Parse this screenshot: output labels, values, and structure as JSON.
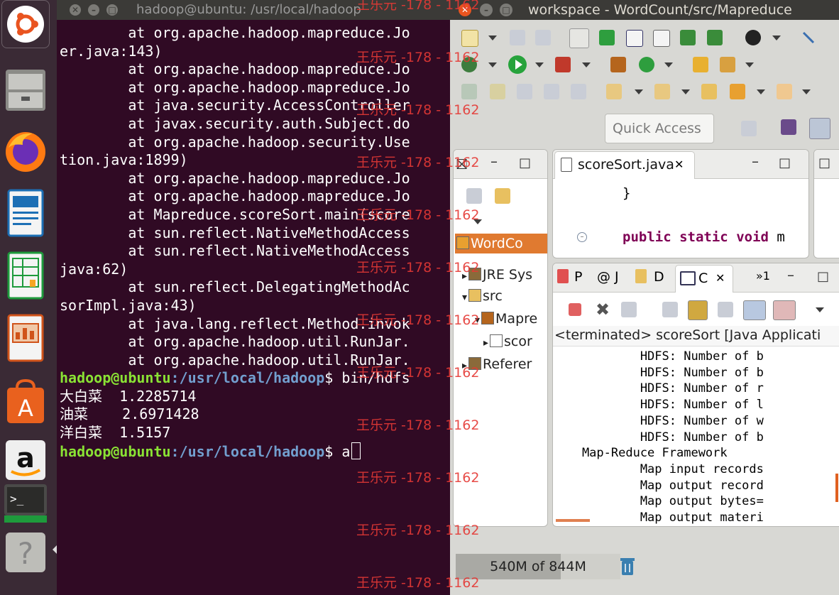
{
  "terminal": {
    "title": "hadoop@ubuntu: /usr/local/hadoop",
    "lines": [
      {
        "t": "        at org.apache.hadoop.mapreduce.Jo"
      },
      {
        "t": "er.java:143)"
      },
      {
        "t": "        at org.apache.hadoop.mapreduce.Jo"
      },
      {
        "t": "        at org.apache.hadoop.mapreduce.Jo"
      },
      {
        "t": "        at java.security.AccessController"
      },
      {
        "t": "        at javax.security.auth.Subject.do"
      },
      {
        "t": "        at org.apache.hadoop.security.Use"
      },
      {
        "t": "tion.java:1899)"
      },
      {
        "t": "        at org.apache.hadoop.mapreduce.Jo"
      },
      {
        "t": "        at org.apache.hadoop.mapreduce.Jo"
      },
      {
        "t": "        at Mapreduce.scoreSort.main(score"
      },
      {
        "t": "        at sun.reflect.NativeMethodAccess"
      },
      {
        "t": "        at sun.reflect.NativeMethodAccess"
      },
      {
        "t": "java:62)"
      },
      {
        "t": "        at sun.reflect.DelegatingMethodAc"
      },
      {
        "t": "sorImpl.java:43)"
      },
      {
        "t": "        at java.lang.reflect.Method.invok"
      },
      {
        "t": "        at org.apache.hadoop.util.RunJar."
      },
      {
        "t": "        at org.apache.hadoop.util.RunJar."
      },
      {
        "user": "hadoop@ubuntu",
        "path": ":/usr/local/hadoop",
        "cmd": "$ bin/hdfs"
      },
      {
        "t": "大白菜  1.2285714"
      },
      {
        "t": "油菜    2.6971428"
      },
      {
        "t": "洋白菜  1.5157"
      },
      {
        "user": "hadoop@ubuntu",
        "path": ":/usr/local/hadoop",
        "cmd": "$ a",
        "cursor": true
      }
    ]
  },
  "eclipse": {
    "title": "workspace - WordCount/src/Mapreduce",
    "quick_access": "Quick Access",
    "explorer_tree": [
      {
        "label": "WordCo",
        "selected": true
      },
      {
        "label": "JRE Sys"
      },
      {
        "label": "src"
      },
      {
        "label": "Mapre"
      },
      {
        "label": "scor"
      },
      {
        "label": "Referer"
      }
    ],
    "editor_tab": "scoreSort.java",
    "code_brace": "}",
    "code_kw1": "public",
    "code_kw2": "static",
    "code_kw3": "void",
    "code_rest": " m",
    "bottom_tabs": [
      "P",
      "@ J",
      "D",
      "C"
    ],
    "overflow_count": "»1",
    "console_header": "<terminated> scoreSort [Java Applicati",
    "console_lines": [
      "            HDFS: Number of b",
      "            HDFS: Number of b",
      "            HDFS: Number of r",
      "            HDFS: Number of l",
      "            HDFS: Number of w",
      "            HDFS: Number of b",
      "    Map-Reduce Framework",
      "            Map input records",
      "            Map output record",
      "            Map output bytes=",
      "            Map output materi"
    ],
    "heap_label": "540M of 844M",
    "heap_used_fraction": 0.64
  },
  "watermark": "王乐元 -178 - 1162",
  "colors": {
    "terminal_bg": "#300a24",
    "prompt_user": "#8ae234",
    "prompt_path": "#729fcf",
    "watermark": "#e53935",
    "keyword": "#7f0055"
  }
}
